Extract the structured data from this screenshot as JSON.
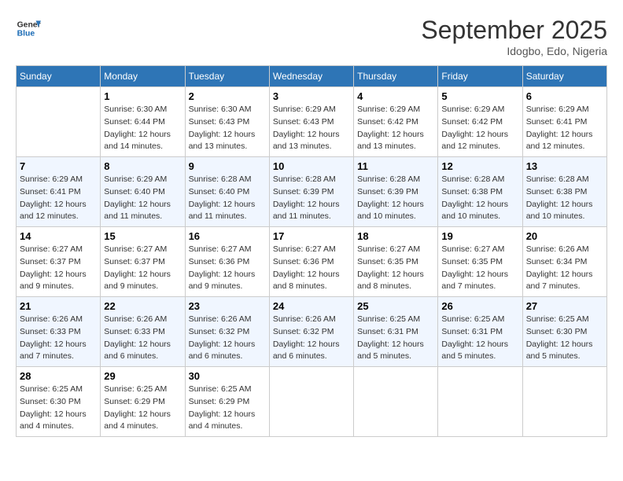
{
  "header": {
    "logo_line1": "General",
    "logo_line2": "Blue",
    "month_title": "September 2025",
    "subtitle": "Idogbo, Edo, Nigeria"
  },
  "weekdays": [
    "Sunday",
    "Monday",
    "Tuesday",
    "Wednesday",
    "Thursday",
    "Friday",
    "Saturday"
  ],
  "weeks": [
    [
      {
        "day": "",
        "info": ""
      },
      {
        "day": "1",
        "info": "Sunrise: 6:30 AM\nSunset: 6:44 PM\nDaylight: 12 hours\nand 14 minutes."
      },
      {
        "day": "2",
        "info": "Sunrise: 6:30 AM\nSunset: 6:43 PM\nDaylight: 12 hours\nand 13 minutes."
      },
      {
        "day": "3",
        "info": "Sunrise: 6:29 AM\nSunset: 6:43 PM\nDaylight: 12 hours\nand 13 minutes."
      },
      {
        "day": "4",
        "info": "Sunrise: 6:29 AM\nSunset: 6:42 PM\nDaylight: 12 hours\nand 13 minutes."
      },
      {
        "day": "5",
        "info": "Sunrise: 6:29 AM\nSunset: 6:42 PM\nDaylight: 12 hours\nand 12 minutes."
      },
      {
        "day": "6",
        "info": "Sunrise: 6:29 AM\nSunset: 6:41 PM\nDaylight: 12 hours\nand 12 minutes."
      }
    ],
    [
      {
        "day": "7",
        "info": "Sunrise: 6:29 AM\nSunset: 6:41 PM\nDaylight: 12 hours\nand 12 minutes."
      },
      {
        "day": "8",
        "info": "Sunrise: 6:29 AM\nSunset: 6:40 PM\nDaylight: 12 hours\nand 11 minutes."
      },
      {
        "day": "9",
        "info": "Sunrise: 6:28 AM\nSunset: 6:40 PM\nDaylight: 12 hours\nand 11 minutes."
      },
      {
        "day": "10",
        "info": "Sunrise: 6:28 AM\nSunset: 6:39 PM\nDaylight: 12 hours\nand 11 minutes."
      },
      {
        "day": "11",
        "info": "Sunrise: 6:28 AM\nSunset: 6:39 PM\nDaylight: 12 hours\nand 10 minutes."
      },
      {
        "day": "12",
        "info": "Sunrise: 6:28 AM\nSunset: 6:38 PM\nDaylight: 12 hours\nand 10 minutes."
      },
      {
        "day": "13",
        "info": "Sunrise: 6:28 AM\nSunset: 6:38 PM\nDaylight: 12 hours\nand 10 minutes."
      }
    ],
    [
      {
        "day": "14",
        "info": "Sunrise: 6:27 AM\nSunset: 6:37 PM\nDaylight: 12 hours\nand 9 minutes."
      },
      {
        "day": "15",
        "info": "Sunrise: 6:27 AM\nSunset: 6:37 PM\nDaylight: 12 hours\nand 9 minutes."
      },
      {
        "day": "16",
        "info": "Sunrise: 6:27 AM\nSunset: 6:36 PM\nDaylight: 12 hours\nand 9 minutes."
      },
      {
        "day": "17",
        "info": "Sunrise: 6:27 AM\nSunset: 6:36 PM\nDaylight: 12 hours\nand 8 minutes."
      },
      {
        "day": "18",
        "info": "Sunrise: 6:27 AM\nSunset: 6:35 PM\nDaylight: 12 hours\nand 8 minutes."
      },
      {
        "day": "19",
        "info": "Sunrise: 6:27 AM\nSunset: 6:35 PM\nDaylight: 12 hours\nand 7 minutes."
      },
      {
        "day": "20",
        "info": "Sunrise: 6:26 AM\nSunset: 6:34 PM\nDaylight: 12 hours\nand 7 minutes."
      }
    ],
    [
      {
        "day": "21",
        "info": "Sunrise: 6:26 AM\nSunset: 6:33 PM\nDaylight: 12 hours\nand 7 minutes."
      },
      {
        "day": "22",
        "info": "Sunrise: 6:26 AM\nSunset: 6:33 PM\nDaylight: 12 hours\nand 6 minutes."
      },
      {
        "day": "23",
        "info": "Sunrise: 6:26 AM\nSunset: 6:32 PM\nDaylight: 12 hours\nand 6 minutes."
      },
      {
        "day": "24",
        "info": "Sunrise: 6:26 AM\nSunset: 6:32 PM\nDaylight: 12 hours\nand 6 minutes."
      },
      {
        "day": "25",
        "info": "Sunrise: 6:25 AM\nSunset: 6:31 PM\nDaylight: 12 hours\nand 5 minutes."
      },
      {
        "day": "26",
        "info": "Sunrise: 6:25 AM\nSunset: 6:31 PM\nDaylight: 12 hours\nand 5 minutes."
      },
      {
        "day": "27",
        "info": "Sunrise: 6:25 AM\nSunset: 6:30 PM\nDaylight: 12 hours\nand 5 minutes."
      }
    ],
    [
      {
        "day": "28",
        "info": "Sunrise: 6:25 AM\nSunset: 6:30 PM\nDaylight: 12 hours\nand 4 minutes."
      },
      {
        "day": "29",
        "info": "Sunrise: 6:25 AM\nSunset: 6:29 PM\nDaylight: 12 hours\nand 4 minutes."
      },
      {
        "day": "30",
        "info": "Sunrise: 6:25 AM\nSunset: 6:29 PM\nDaylight: 12 hours\nand 4 minutes."
      },
      {
        "day": "",
        "info": ""
      },
      {
        "day": "",
        "info": ""
      },
      {
        "day": "",
        "info": ""
      },
      {
        "day": "",
        "info": ""
      }
    ]
  ]
}
